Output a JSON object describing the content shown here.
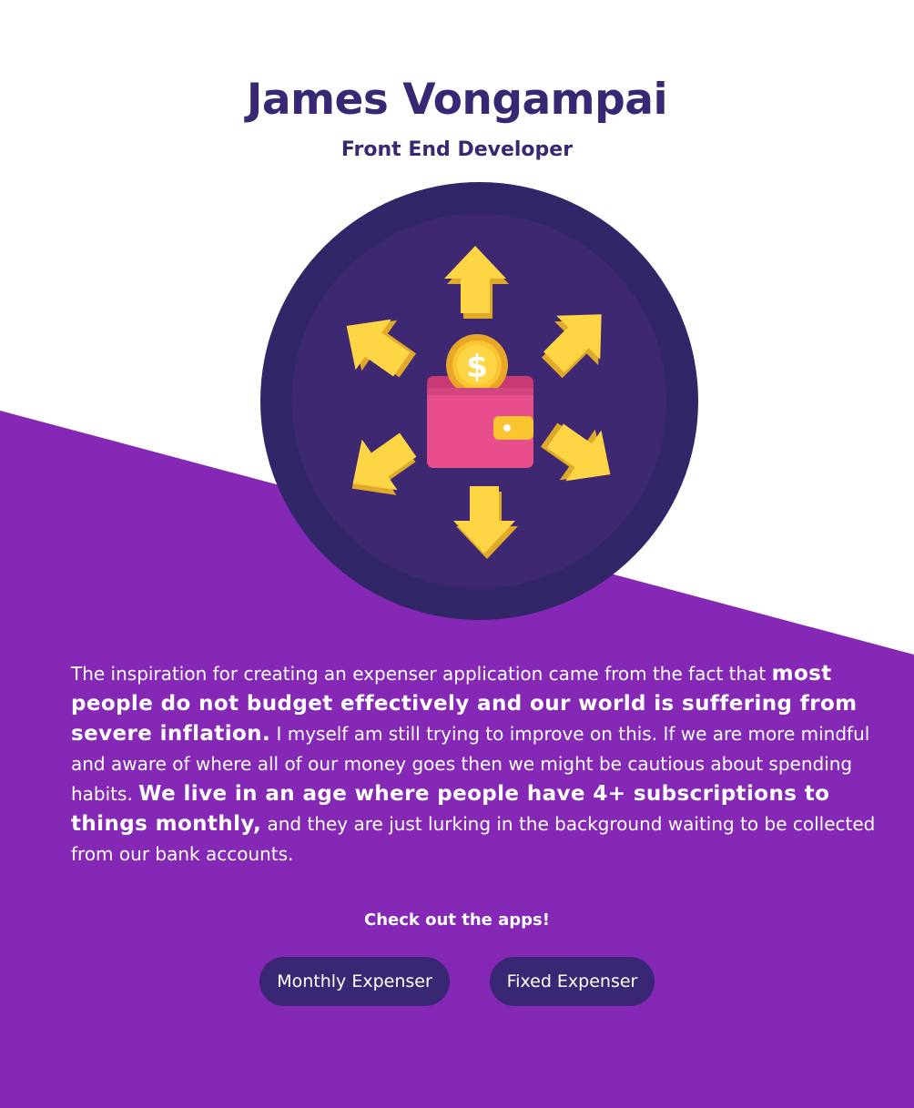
{
  "header": {
    "name": "James Vongampai",
    "role": "Front End Developer"
  },
  "hero": {
    "icon": "wallet-with-coin-and-arrows",
    "coin_symbol": "$"
  },
  "bio": {
    "p1": "The inspiration for creating an expenser application came from the fact that ",
    "em1": "most people do not budget effectively and our world is suffering from severe inflation.",
    "p2": " I myself am still trying to improve on this. If we are more mindful and aware of where all of our money goes then we might be cautious about spending habits. ",
    "em2": "We live in an age where people have 4+ subscriptions to things monthly,",
    "p3": " and they are just lurking in the background waiting to be collected from our bank accounts."
  },
  "cta": {
    "heading": "Check out the apps!",
    "buttons": [
      {
        "label": "Monthly Expenser"
      },
      {
        "label": "Fixed Expenser"
      }
    ]
  },
  "colors": {
    "background_top": "#ffffff",
    "background_bottom": "#8528b5",
    "heading": "#3a2774",
    "button_bg": "#3a2774",
    "circle_outer": "#312668",
    "circle_inner": "#3e2872",
    "arrow": "#fdd545",
    "wallet": "#e84e8c",
    "coin": "#fbc531"
  }
}
